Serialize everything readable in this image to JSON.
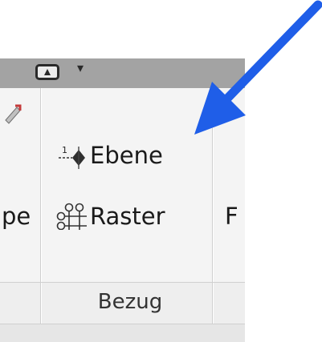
{
  "ribbon": {
    "panel": {
      "title": "Bezug",
      "tools": [
        {
          "label": "Ebene",
          "icon": "reference-plane-icon"
        },
        {
          "label": "Raster",
          "icon": "grid-icon"
        }
      ]
    },
    "left_partial_label": "pe",
    "right_partial_label": "F"
  },
  "annotation": {
    "icon": "pointer-arrow-icon",
    "color": "#1f5ee8"
  }
}
